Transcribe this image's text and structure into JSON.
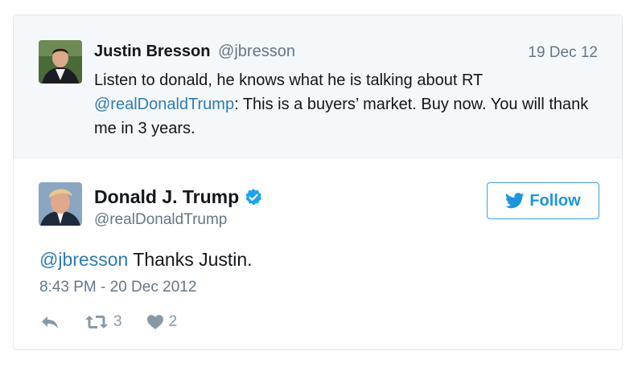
{
  "quoted_tweet": {
    "author_name": "Justin Bresson",
    "author_handle": "@jbresson",
    "date": "19 Dec 12",
    "text_line1": "Listen to donald, he knows what he is talking about RT",
    "mention": "@realDonaldTrump",
    "text_rest": ": This is a buyers’ market. Buy now. You will thank me in 3 years."
  },
  "main_tweet": {
    "author_name": "Donald J. Trump",
    "author_handle": "@realDonaldTrump",
    "verified": true,
    "follow_label": "Follow",
    "mention": "@jbresson",
    "text": " Thanks Justin.",
    "timestamp": "8:43 PM - 20 Dec 2012",
    "retweet_count": "3",
    "like_count": "2"
  },
  "colors": {
    "link": "#2b7bb9",
    "follow": "#1b95e0",
    "muted": "#657786",
    "quoted_bg": "#f5f8fa"
  },
  "icons": [
    "reply-icon",
    "retweet-icon",
    "heart-icon",
    "verified-badge-icon",
    "twitter-bird-icon"
  ]
}
